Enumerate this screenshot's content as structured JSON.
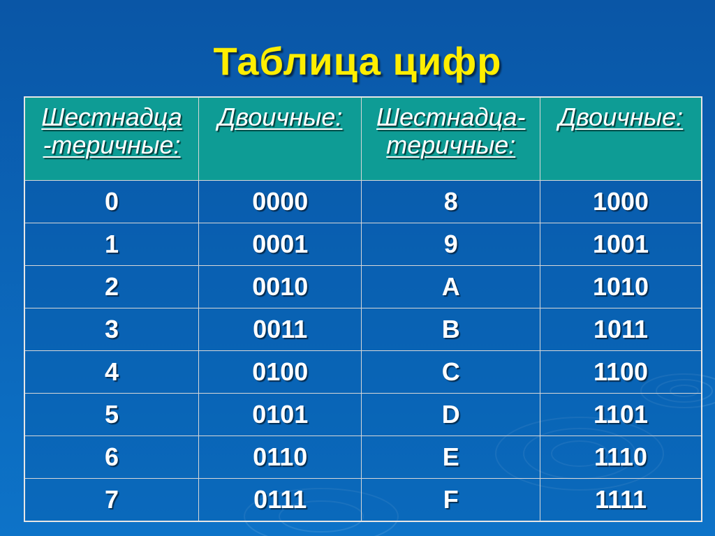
{
  "slide": {
    "title": "Таблица цифр"
  },
  "table": {
    "headers": [
      [
        "Шестнадца",
        "-теричные:"
      ],
      [
        "Двоичные:",
        ""
      ],
      [
        "Шестнадца-",
        "теричные:"
      ],
      [
        "Двоичные:",
        ""
      ]
    ],
    "rows": [
      [
        "0",
        "0000",
        "8",
        "1000"
      ],
      [
        "1",
        "0001",
        "9",
        "1001"
      ],
      [
        "2",
        "0010",
        "A",
        "1010"
      ],
      [
        "3",
        "0011",
        "B",
        "1011"
      ],
      [
        "4",
        "0100",
        "C",
        "1100"
      ],
      [
        "5",
        "0101",
        "D",
        "1101"
      ],
      [
        "6",
        "0110",
        "E",
        "1110"
      ],
      [
        "7",
        "0111",
        "F",
        "1111"
      ]
    ]
  },
  "colors": {
    "background": "#0b63b6",
    "title": "#ffee00",
    "header_fill": "#0e9c95",
    "text": "#ffffff",
    "grid": "#d8d8d8"
  }
}
